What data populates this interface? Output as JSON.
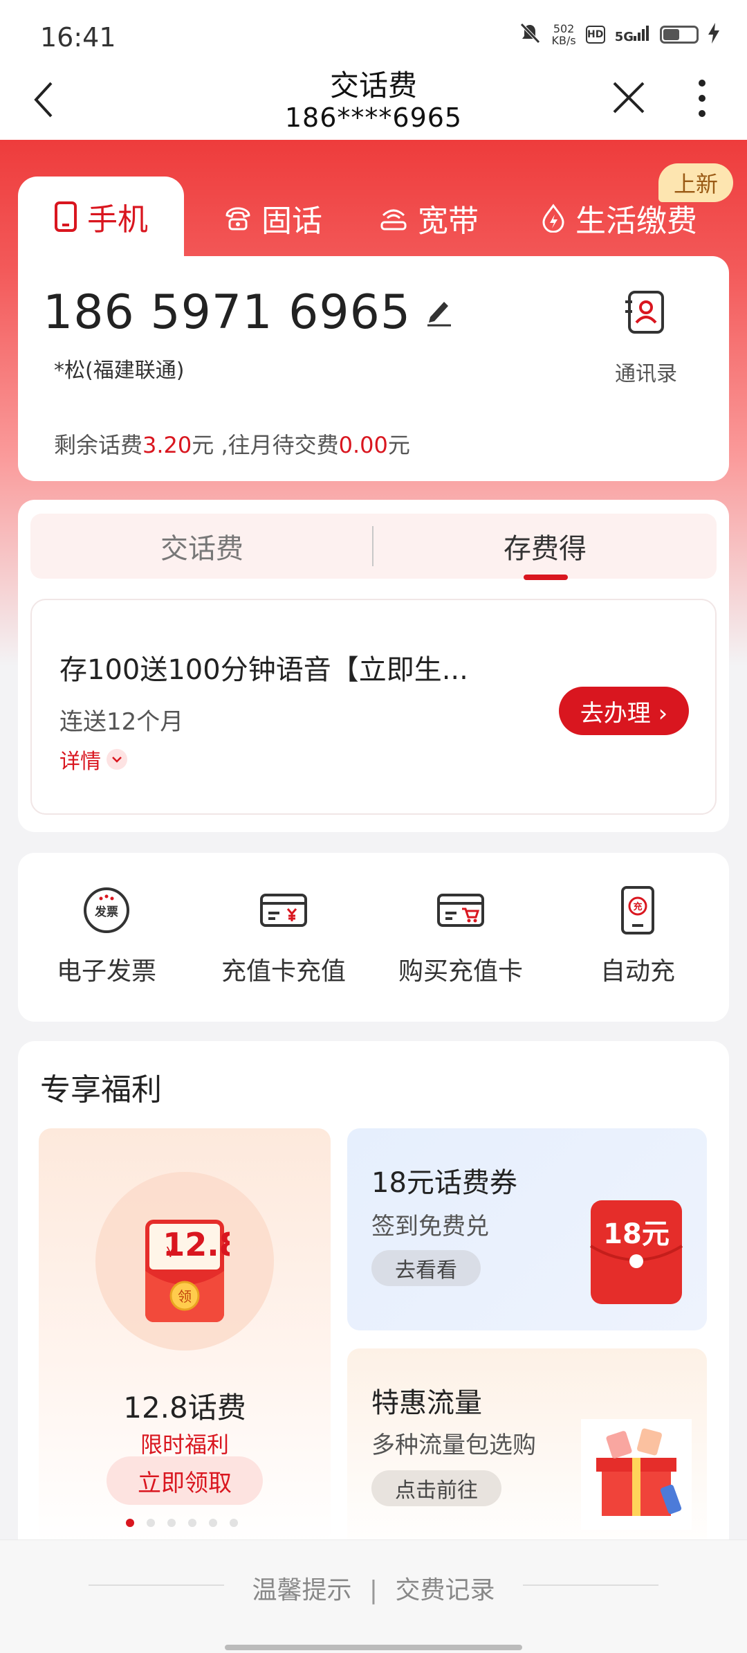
{
  "status_bar": {
    "time": "16:41",
    "net_speed_value": "502",
    "net_speed_unit": "KB/s",
    "hd": "HD",
    "signal": "5G",
    "battery_level": 0.45
  },
  "nav": {
    "title": "交话费",
    "subtitle": "186****6965"
  },
  "tabs": [
    {
      "label": "手机",
      "icon": "phone-icon",
      "active": true
    },
    {
      "label": "固话",
      "icon": "landline-icon",
      "active": false
    },
    {
      "label": "宽带",
      "icon": "broadband-icon",
      "active": false
    },
    {
      "label": "生活缴费",
      "icon": "utility-icon",
      "active": false
    }
  ],
  "tab_badge": "上新",
  "phone_card": {
    "number": "186 5971 6965",
    "operator": "*松(福建联通)",
    "contacts_label": "通讯录",
    "balance_prefix": "剩余话费",
    "balance_value": "3.20",
    "balance_unit": "元",
    "pending_prefix": " ,往月待交费",
    "pending_value": "0.00",
    "pending_unit": "元"
  },
  "sub_tabs": [
    {
      "label": "交话费",
      "active": false
    },
    {
      "label": "存费得",
      "active": true
    }
  ],
  "offer": {
    "title": "存100送100分钟语音【立即生...",
    "desc": "连送12个月",
    "detail_label": "详情",
    "button_label": "去办理 ›"
  },
  "quick_actions": [
    {
      "label": "电子发票",
      "icon": "invoice-icon",
      "icon_text": "发票"
    },
    {
      "label": "充值卡充值",
      "icon": "recharge-card-icon"
    },
    {
      "label": "购买充值卡",
      "icon": "buy-card-icon"
    },
    {
      "label": "自动充",
      "icon": "auto-recharge-icon",
      "icon_text": "充"
    }
  ],
  "benefits": {
    "title": "专享福利",
    "left_promo": {
      "amount": "12.8",
      "currency": "¥",
      "coin_text": "领",
      "title": "12.8话费",
      "subtitle": "限时福利",
      "button": "立即领取"
    },
    "right_promos": [
      {
        "title": "18元话费券",
        "subtitle": "签到免费兑",
        "button": "去看看",
        "image_text": "18元"
      },
      {
        "title": "特惠流量",
        "subtitle": "多种流量包选购",
        "button": "点击前往"
      }
    ],
    "carousel_dots": 6,
    "carousel_active_index": 0
  },
  "bottom_bar": {
    "left": "温馨提示",
    "separator": "|",
    "right": "交费记录"
  },
  "colors": {
    "brand_red": "#d9161f",
    "header_red": "#ee3c3c",
    "badge_bg": "#fde5b0"
  }
}
